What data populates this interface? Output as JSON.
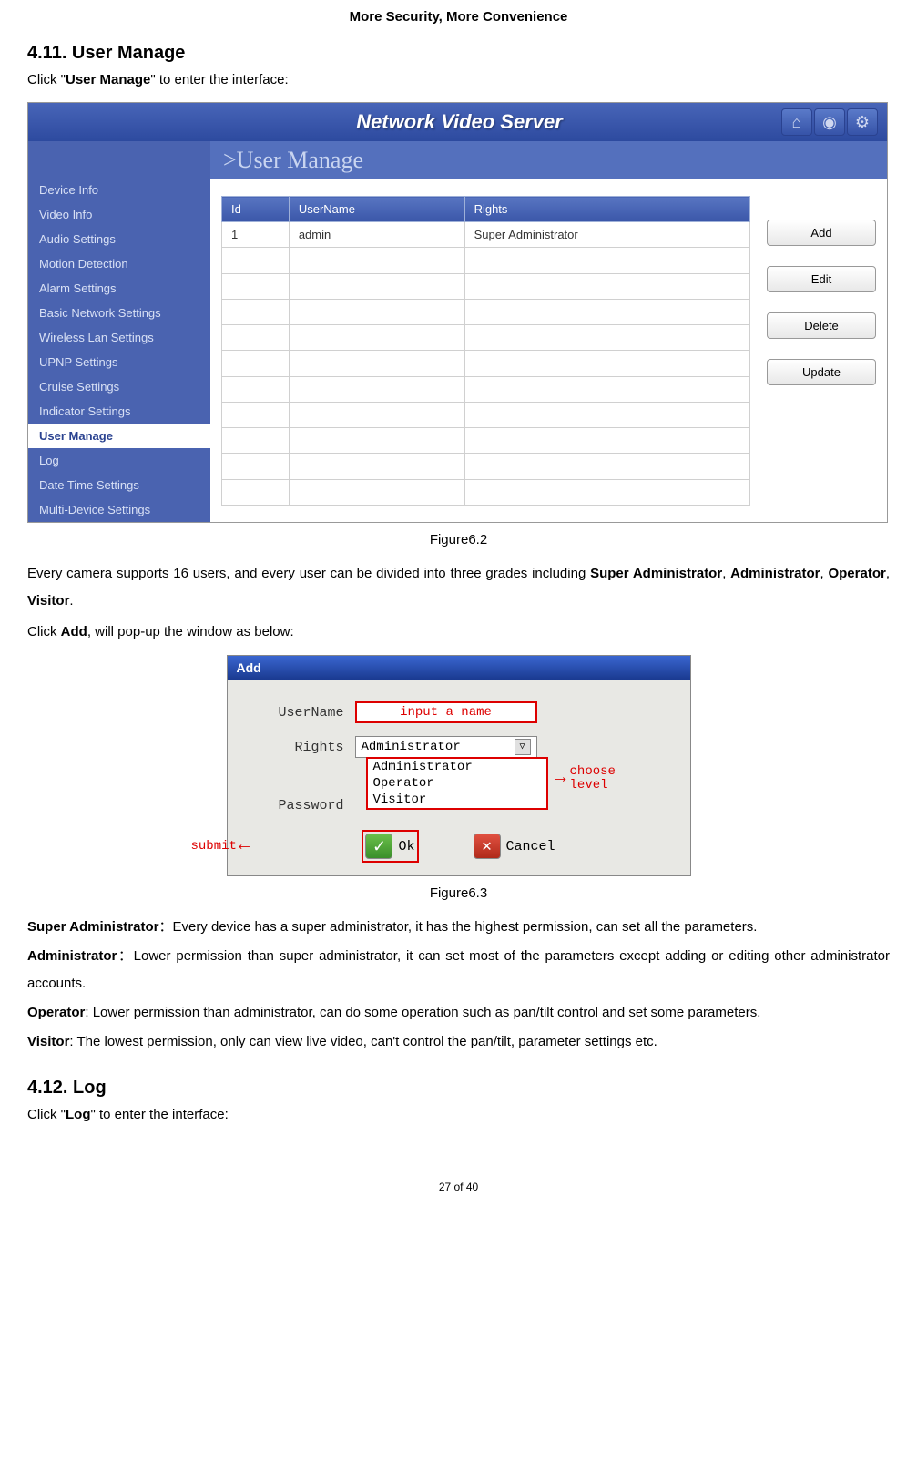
{
  "header": "More Security, More Convenience",
  "section411": {
    "heading": "4.11. User Manage",
    "intro_prefix": "Click \"",
    "intro_bold": "User Manage",
    "intro_suffix": "\" to enter the interface:"
  },
  "screenshot1": {
    "title": "Network Video Server",
    "breadcrumb": ">User Manage",
    "sidebar": [
      "Device Info",
      "Video Info",
      "Audio Settings",
      "Motion Detection",
      "Alarm Settings",
      "Basic Network Settings",
      "Wireless Lan Settings",
      "UPNP Settings",
      "Cruise Settings",
      "Indicator Settings",
      "User Manage",
      "Log",
      "Date Time Settings",
      "Multi-Device Settings"
    ],
    "active_sidebar": "User Manage",
    "table_headers": [
      "Id",
      "UserName",
      "Rights"
    ],
    "table_rows": [
      {
        "id": "1",
        "username": "admin",
        "rights": "Super Administrator"
      }
    ],
    "empty_rows": 10,
    "buttons": [
      "Add",
      "Edit",
      "Delete",
      "Update"
    ]
  },
  "figure62": "Figure6.2",
  "para1_a": "Every camera supports 16 users, and every user can be divided into three grades including ",
  "para1_b": "Super Administrator",
  "para1_c": ", ",
  "para1_d": "Administrator",
  "para1_e": ", ",
  "para1_f": "Operator",
  "para1_g": ", ",
  "para1_h": "Visitor",
  "para1_i": ".",
  "para2_a": "Click ",
  "para2_b": "Add",
  "para2_c": ", will pop-up the window as below:",
  "screenshot2": {
    "title": "Add",
    "username_label": "UserName",
    "username_value": "input a name",
    "rights_label": "Rights",
    "rights_value": "Administrator",
    "dropdown_options": [
      "Administrator",
      "Operator",
      "Visitor"
    ],
    "password_label": "Password",
    "choose_level": "choose level",
    "submit_anno": "submit",
    "ok": "Ok",
    "cancel": "Cancel"
  },
  "figure63": "Figure6.3",
  "roles": {
    "super_label": "Super Administrator",
    "super_desc": "：Every device has a super administrator, it has the highest permission, can set all the parameters.",
    "admin_label": "Administrator",
    "admin_desc": "：Lower permission than super administrator, it can set most of the parameters except adding or editing other administrator accounts.",
    "operator_label": "Operator",
    "operator_desc": ": Lower permission than administrator, can do some operation such as pan/tilt control and set some parameters.",
    "visitor_label": "Visitor",
    "visitor_desc": ": The lowest permission, only can view live video, can't control the pan/tilt, parameter settings etc."
  },
  "section412": {
    "heading": "4.12. Log",
    "intro_prefix": "Click \"",
    "intro_bold": "Log",
    "intro_suffix": "\" to enter the interface:"
  },
  "page_footer": "27 of 40"
}
